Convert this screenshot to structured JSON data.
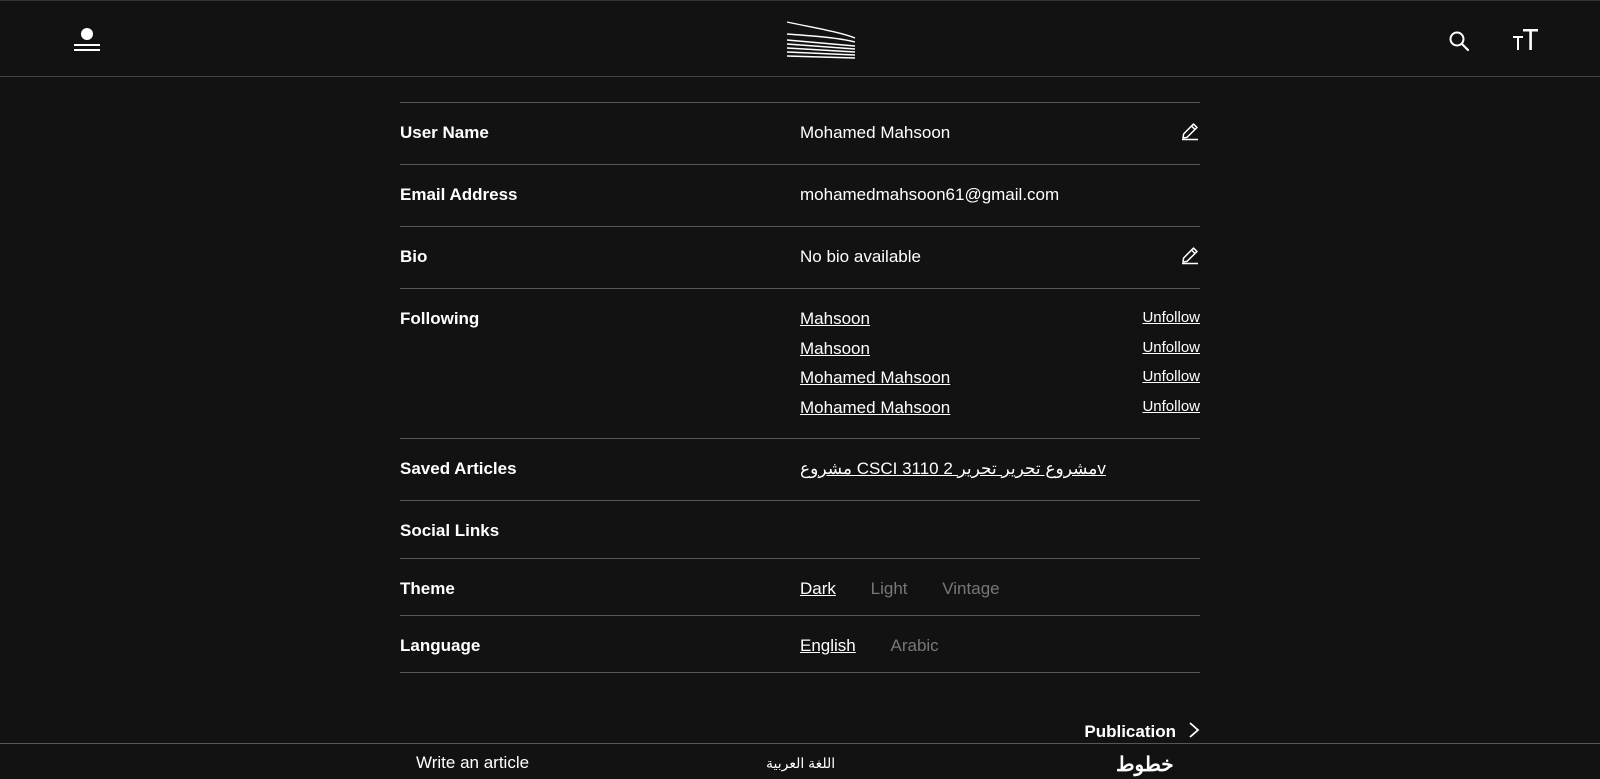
{
  "header": {
    "user_icon": "user-menu-icon",
    "logo_icon": "logo-icon",
    "search_icon": "search-icon",
    "font_icon": "font-size-icon"
  },
  "settings": {
    "user_name": {
      "label": "User Name",
      "value": "Mohamed Mahsoon"
    },
    "email": {
      "label": "Email Address",
      "value": "mohamedmahsoon61@gmail.com"
    },
    "bio": {
      "label": "Bio",
      "value": "No bio available"
    },
    "following": {
      "label": "Following",
      "unfollow_label": "Unfollow",
      "items": [
        {
          "name": "Mahsoon"
        },
        {
          "name": "Mahsoon"
        },
        {
          "name": "Mohamed Mahsoon"
        },
        {
          "name": "Mohamed Mahsoon"
        }
      ]
    },
    "saved_articles": {
      "label": "Saved Articles",
      "value": "مشروع CSCI 3110 2 مشروع تحرير تحريرv"
    },
    "social_links": {
      "label": "Social Links"
    },
    "theme": {
      "label": "Theme",
      "options": [
        "Dark",
        "Light",
        "Vintage"
      ],
      "selected": "Dark"
    },
    "language": {
      "label": "Language",
      "options": [
        "English",
        "Arabic"
      ],
      "selected": "English"
    }
  },
  "publication_label": "Publication",
  "footer": {
    "write_label": "Write an article",
    "arabic_label": "اللغة العربية",
    "brand_label": "خطوط"
  },
  "colors": {
    "background": "#121212",
    "text": "#ffffff",
    "muted": "#777777",
    "divider": "#555555"
  }
}
